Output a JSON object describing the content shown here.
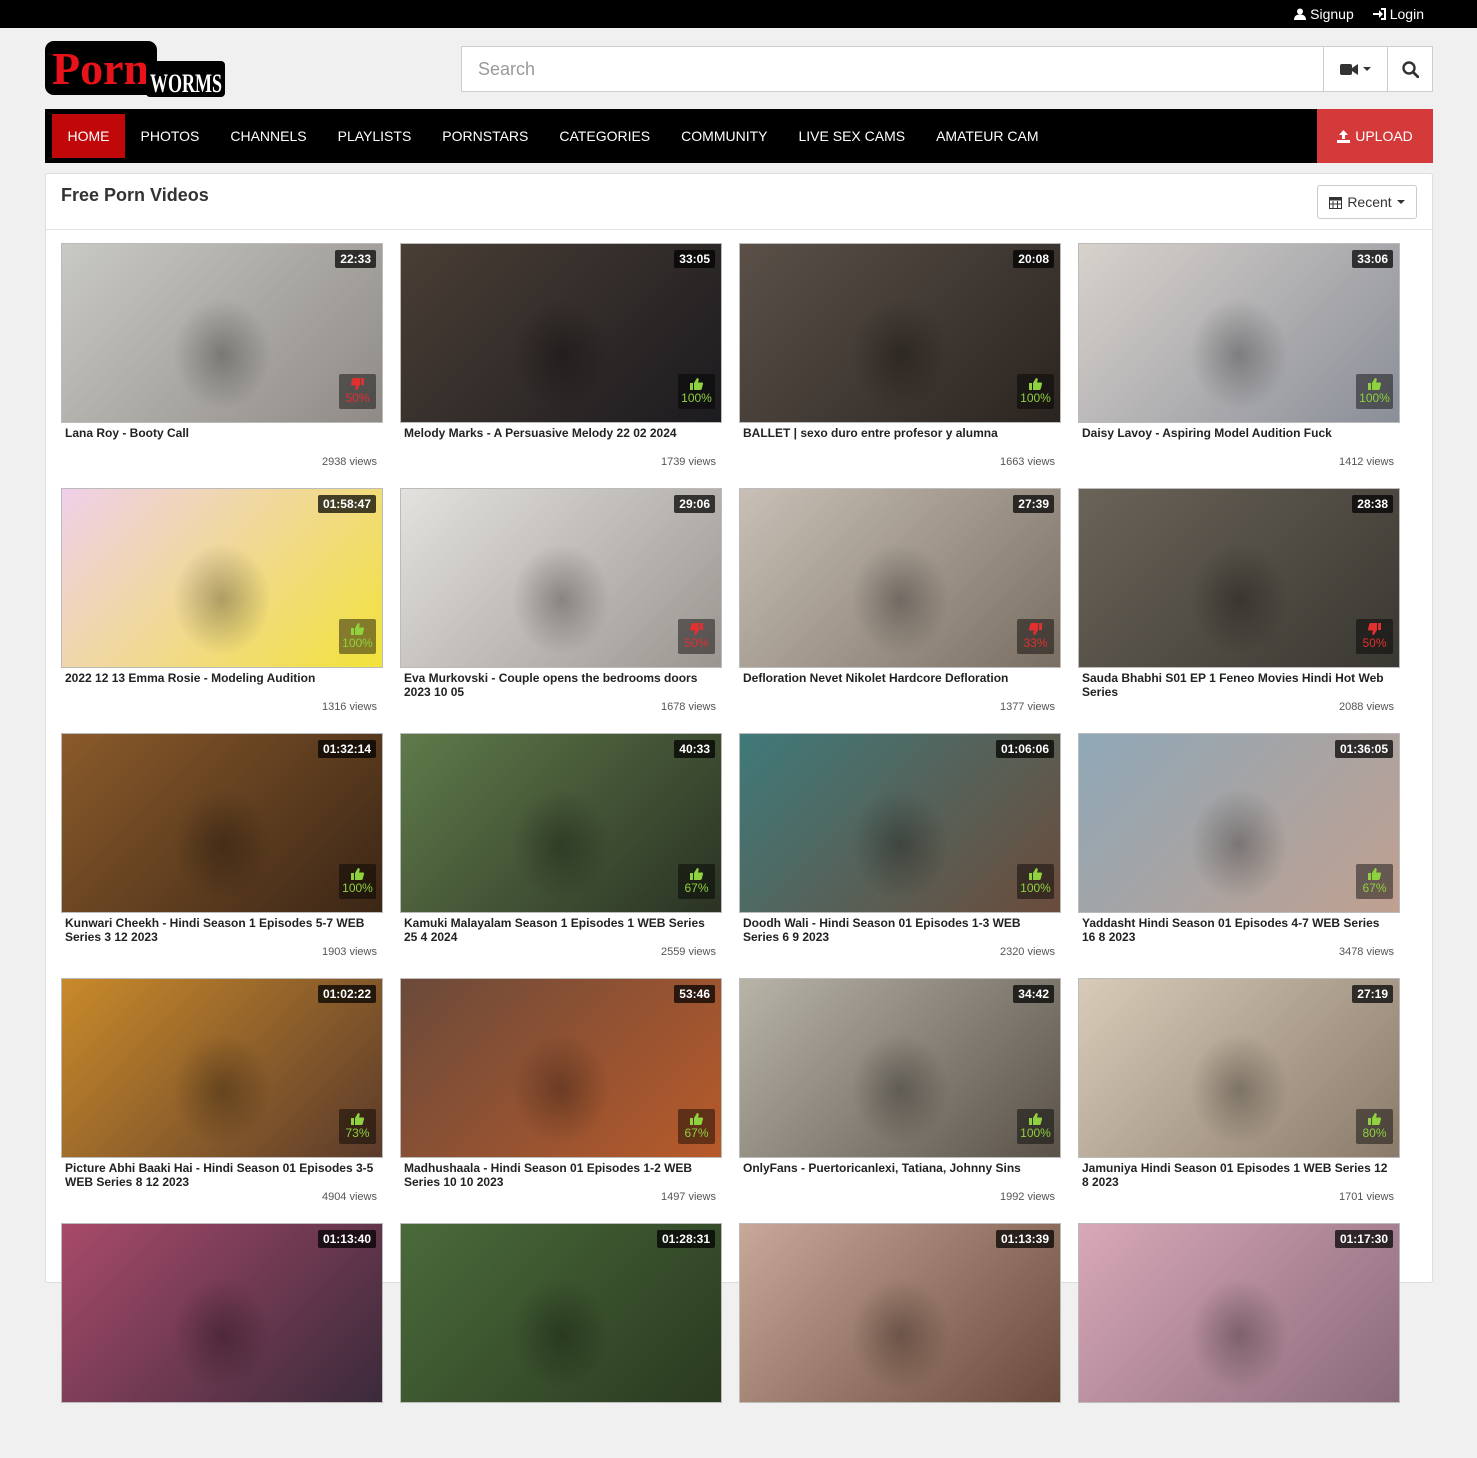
{
  "topbar": {
    "signup": "Signup",
    "login": "Login"
  },
  "logo": {
    "text_main": "Porn",
    "text_sub": "WORMS"
  },
  "search": {
    "placeholder": "Search"
  },
  "nav": {
    "items": [
      "HOME",
      "PHOTOS",
      "CHANNELS",
      "PLAYLISTS",
      "PORNSTARS",
      "CATEGORIES",
      "COMMUNITY",
      "LIVE SEX CAMS",
      "AMATEUR CAM"
    ],
    "active": "HOME",
    "upload": "UPLOAD"
  },
  "panel": {
    "title": "Free Porn Videos",
    "sort_label": "Recent"
  },
  "colors": {
    "brand_red": "#c0080a",
    "upload_red": "#d43a3a",
    "rating_good": "#8fd13f",
    "rating_bad": "#e03030"
  },
  "videos": [
    {
      "title": "Lana Roy - Booty Call",
      "duration": "22:33",
      "rating": "50%",
      "thumb": "down",
      "views": "2938 views"
    },
    {
      "title": "Melody Marks - A Persuasive Melody 22 02 2024",
      "duration": "33:05",
      "rating": "100%",
      "thumb": "up",
      "views": "1739 views"
    },
    {
      "title": "BALLET | sexo duro entre profesor y alumna",
      "duration": "20:08",
      "rating": "100%",
      "thumb": "up",
      "views": "1663 views"
    },
    {
      "title": "Daisy Lavoy - Aspiring Model Audition Fuck",
      "duration": "33:06",
      "rating": "100%",
      "thumb": "up",
      "views": "1412 views"
    },
    {
      "title": "2022 12 13 Emma Rosie - Modeling Audition",
      "duration": "01:58:47",
      "rating": "100%",
      "thumb": "up",
      "views": "1316 views"
    },
    {
      "title": "Eva Murkovski - Couple opens the bedrooms doors 2023 10 05",
      "duration": "29:06",
      "rating": "50%",
      "thumb": "down",
      "views": "1678 views"
    },
    {
      "title": "Defloration Nevet Nikolet Hardcore Defloration",
      "duration": "27:39",
      "rating": "33%",
      "thumb": "down",
      "views": "1377 views"
    },
    {
      "title": "Sauda Bhabhi S01 EP 1 Feneo Movies Hindi Hot Web Series",
      "duration": "28:38",
      "rating": "50%",
      "thumb": "down",
      "views": "2088 views"
    },
    {
      "title": "Kunwari Cheekh - Hindi Season 1 Episodes 5-7 WEB Series 3 12 2023",
      "duration": "01:32:14",
      "rating": "100%",
      "thumb": "up",
      "views": "1903 views"
    },
    {
      "title": "Kamuki Malayalam Season 1 Episodes 1 WEB Series 25 4 2024",
      "duration": "40:33",
      "rating": "67%",
      "thumb": "up",
      "views": "2559 views"
    },
    {
      "title": "Doodh Wali - Hindi Season 01 Episodes 1-3 WEB Series 6 9 2023",
      "duration": "01:06:06",
      "rating": "100%",
      "thumb": "up",
      "views": "2320 views"
    },
    {
      "title": "Yaddasht Hindi Season 01 Episodes 4-7 WEB Series 16 8 2023",
      "duration": "01:36:05",
      "rating": "67%",
      "thumb": "up",
      "views": "3478 views"
    },
    {
      "title": "Picture Abhi Baaki Hai - Hindi Season 01 Episodes 3-5 WEB Series 8 12 2023",
      "duration": "01:02:22",
      "rating": "73%",
      "thumb": "up",
      "views": "4904 views"
    },
    {
      "title": "Madhushaala - Hindi Season 01 Episodes 1-2 WEB Series 10 10 2023",
      "duration": "53:46",
      "rating": "67%",
      "thumb": "up",
      "views": "1497 views"
    },
    {
      "title": "OnlyFans - Puertoricanlexi, Tatiana, Johnny Sins",
      "duration": "34:42",
      "rating": "100%",
      "thumb": "up",
      "views": "1992 views"
    },
    {
      "title": "Jamuniya Hindi Season 01 Episodes 1 WEB Series 12 8 2023",
      "duration": "27:19",
      "rating": "80%",
      "thumb": "up",
      "views": "1701 views"
    },
    {
      "title": "",
      "duration": "01:13:40",
      "rating": "",
      "thumb": "",
      "views": ""
    },
    {
      "title": "",
      "duration": "01:28:31",
      "rating": "",
      "thumb": "",
      "views": ""
    },
    {
      "title": "",
      "duration": "01:13:39",
      "rating": "",
      "thumb": "",
      "views": ""
    },
    {
      "title": "",
      "duration": "01:17:30",
      "rating": "",
      "thumb": "",
      "views": ""
    }
  ]
}
